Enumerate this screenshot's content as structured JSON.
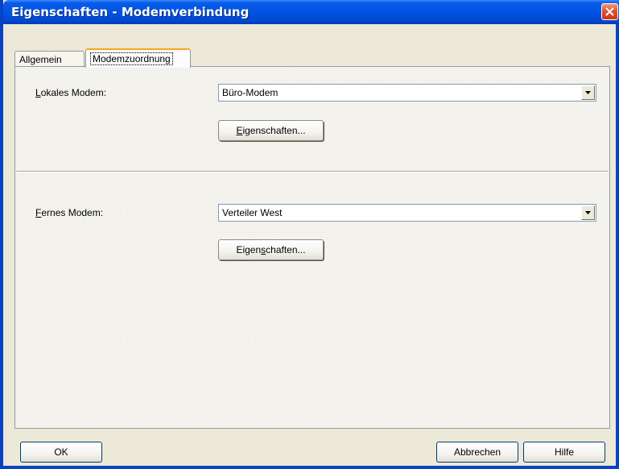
{
  "window": {
    "title": "Eigenschaften - Modemverbindung"
  },
  "tabs": [
    {
      "label": "Allgemein",
      "active": false
    },
    {
      "label": "Modemzuordnung",
      "active": true
    }
  ],
  "local_modem": {
    "label_accel": "L",
    "label_rest": "okales Modem:",
    "value": "Büro-Modem",
    "button_pre": "",
    "button_accel": "E",
    "button_post": "igenschaften..."
  },
  "remote_modem": {
    "label_accel": "F",
    "label_rest": "ernes Modem:",
    "value": "Verteiler West",
    "button_pre": "Eigen",
    "button_accel": "s",
    "button_post": "chaften..."
  },
  "footer": {
    "ok_label": "OK",
    "cancel_label": "Abbrechen",
    "help_label": "Hilfe"
  },
  "colors": {
    "titlebar": "#0054E3",
    "dialog_bg": "#ECE9D8",
    "active_tab_highlight": "#F6A91B",
    "close_button": "#E0502C"
  }
}
